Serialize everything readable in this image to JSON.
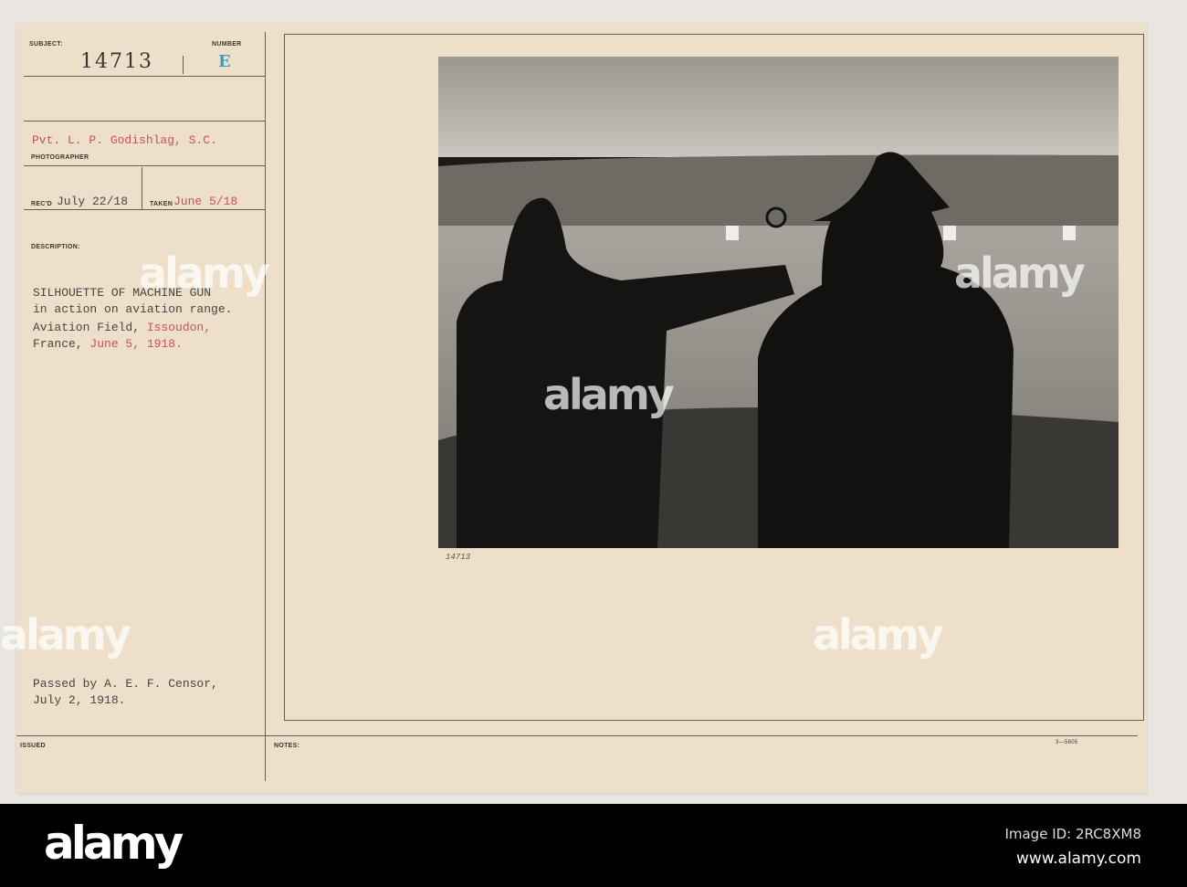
{
  "card": {
    "subject_label": "SUBJECT:",
    "subject_number": "14713",
    "number_label": "NUMBER",
    "number_value": "E",
    "photographer": "Pvt. L. P. Godishlag, S.C.",
    "photographer_label": "PHOTOGRAPHER",
    "recd_label": "REC'D",
    "recd_value": "July 22/18",
    "taken_label": "TAKEN",
    "taken_value": "June 5/18",
    "description_label": "DESCRIPTION:",
    "description_lines": [
      "SILHOUETTE OF MACHINE GUN",
      "in action on aviation range.",
      "Aviation Field, ",
      "France, "
    ],
    "description_red": [
      "Issoudon,",
      "June 5, 1918."
    ],
    "censor_lines": [
      "Passed by A. E. F. Censor,",
      "July 2, 1918."
    ],
    "issued_label": "ISSUED",
    "notes_label": "NOTES:",
    "form_number": "3—5605",
    "photo_caption": "14713"
  },
  "colors": {
    "paper": "#eedfcb",
    "red_ink": "#c8525a",
    "blue_ink": "#4a9ab8"
  },
  "watermark": {
    "brand": "alamy",
    "image_id": "Image ID: 2RC8XM8",
    "url": "www.alamy.com"
  }
}
